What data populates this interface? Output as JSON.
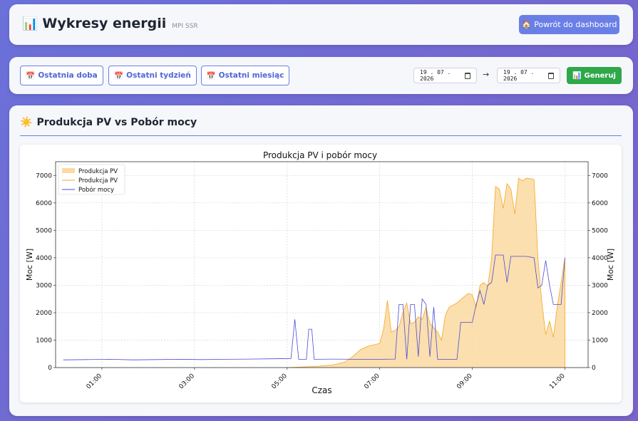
{
  "header": {
    "icon": "bar-chart-icon",
    "title": "Wykresy energii",
    "subtitle": "MPI SSR",
    "back_button": "Powrót do dashboard",
    "back_icon": "home-icon"
  },
  "controls": {
    "ranges": [
      {
        "label": "Ostatnia doba",
        "icon": "calendar-icon"
      },
      {
        "label": "Ostatni tydzień",
        "icon": "calendar-icon"
      },
      {
        "label": "Ostatni miesiąc",
        "icon": "calendar-icon"
      }
    ],
    "date_from": "19 . 07 . 2026",
    "date_to": "19 . 07 . 2026",
    "arrow": "→",
    "generate_button": "Generuj",
    "generate_icon": "chart-icon"
  },
  "section": {
    "icon": "sun-icon",
    "title": "Produkcja PV vs Pobór mocy"
  },
  "colors": {
    "pv_fill": "#fcd9a0",
    "pv_line": "#f5a623",
    "load_line": "#4a4ad8",
    "accent": "#6a7fe6",
    "generate": "#2ea84a"
  },
  "chart_data": {
    "type": "area",
    "title": "Produkcja PV i pobór mocy",
    "xlabel": "Czas",
    "ylabel": "Moc [W]",
    "ylabel_right": "Moc [W]",
    "xlim": [
      "00:00",
      "11:30"
    ],
    "ylim": [
      0,
      7500
    ],
    "x_ticks": [
      "01:00",
      "03:00",
      "05:00",
      "07:00",
      "09:00",
      "11:00"
    ],
    "y_ticks": [
      0,
      1000,
      2000,
      3000,
      4000,
      5000,
      6000,
      7000
    ],
    "grid": true,
    "legend_position": "top-left",
    "legend": [
      "Produkcja PV",
      "Produkcja PV",
      "Pobór mocy"
    ],
    "series": [
      {
        "name": "Produkcja PV",
        "kind": "area",
        "points": [
          [
            "05:00",
            0
          ],
          [
            "05:20",
            20
          ],
          [
            "05:40",
            50
          ],
          [
            "06:00",
            100
          ],
          [
            "06:15",
            200
          ],
          [
            "06:25",
            400
          ],
          [
            "06:35",
            650
          ],
          [
            "06:45",
            780
          ],
          [
            "07:00",
            880
          ],
          [
            "07:05",
            1400
          ],
          [
            "07:10",
            2450
          ],
          [
            "07:15",
            1300
          ],
          [
            "07:20",
            1350
          ],
          [
            "07:25",
            1500
          ],
          [
            "07:30",
            2000
          ],
          [
            "07:35",
            2350
          ],
          [
            "07:40",
            1600
          ],
          [
            "07:45",
            1650
          ],
          [
            "07:50",
            1850
          ],
          [
            "07:55",
            1750
          ],
          [
            "08:00",
            2200
          ],
          [
            "08:05",
            1600
          ],
          [
            "08:10",
            1450
          ],
          [
            "08:15",
            1300
          ],
          [
            "08:20",
            1000
          ],
          [
            "08:25",
            1900
          ],
          [
            "08:30",
            2200
          ],
          [
            "08:40",
            2350
          ],
          [
            "08:50",
            2600
          ],
          [
            "08:55",
            2700
          ],
          [
            "09:00",
            2650
          ],
          [
            "09:05",
            2200
          ],
          [
            "09:10",
            3000
          ],
          [
            "09:15",
            3100
          ],
          [
            "09:20",
            2950
          ],
          [
            "09:25",
            4000
          ],
          [
            "09:30",
            6600
          ],
          [
            "09:35",
            6500
          ],
          [
            "09:40",
            5800
          ],
          [
            "09:45",
            6700
          ],
          [
            "09:50",
            6500
          ],
          [
            "09:55",
            5600
          ],
          [
            "10:00",
            6900
          ],
          [
            "10:05",
            6800
          ],
          [
            "10:10",
            6900
          ],
          [
            "10:15",
            6880
          ],
          [
            "10:20",
            6850
          ],
          [
            "10:25",
            4000
          ],
          [
            "10:30",
            2400
          ],
          [
            "10:35",
            1200
          ],
          [
            "10:40",
            1700
          ],
          [
            "10:45",
            1100
          ],
          [
            "10:50",
            2200
          ],
          [
            "11:00",
            4000
          ],
          [
            "11:00",
            0
          ]
        ]
      },
      {
        "name": "Pobór mocy",
        "kind": "line",
        "points": [
          [
            "00:10",
            280
          ],
          [
            "00:40",
            290
          ],
          [
            "01:10",
            300
          ],
          [
            "01:40",
            280
          ],
          [
            "02:10",
            290
          ],
          [
            "02:40",
            300
          ],
          [
            "03:10",
            290
          ],
          [
            "03:40",
            300
          ],
          [
            "04:10",
            310
          ],
          [
            "04:40",
            320
          ],
          [
            "05:05",
            330
          ],
          [
            "05:10",
            1760
          ],
          [
            "05:15",
            300
          ],
          [
            "05:25",
            300
          ],
          [
            "05:28",
            1400
          ],
          [
            "05:32",
            1400
          ],
          [
            "05:35",
            300
          ],
          [
            "06:00",
            310
          ],
          [
            "06:30",
            300
          ],
          [
            "07:00",
            300
          ],
          [
            "07:20",
            310
          ],
          [
            "07:25",
            2300
          ],
          [
            "07:30",
            2300
          ],
          [
            "07:35",
            300
          ],
          [
            "07:40",
            2300
          ],
          [
            "07:45",
            2300
          ],
          [
            "07:50",
            400
          ],
          [
            "07:55",
            2500
          ],
          [
            "08:00",
            2300
          ],
          [
            "08:05",
            400
          ],
          [
            "08:10",
            2200
          ],
          [
            "08:15",
            300
          ],
          [
            "08:20",
            300
          ],
          [
            "08:40",
            300
          ],
          [
            "08:45",
            1650
          ],
          [
            "09:00",
            1650
          ],
          [
            "09:05",
            2300
          ],
          [
            "09:10",
            2800
          ],
          [
            "09:15",
            2300
          ],
          [
            "09:20",
            3000
          ],
          [
            "09:25",
            3100
          ],
          [
            "09:30",
            4100
          ],
          [
            "09:40",
            4100
          ],
          [
            "09:45",
            3100
          ],
          [
            "09:50",
            4050
          ],
          [
            "10:00",
            4050
          ],
          [
            "10:10",
            4050
          ],
          [
            "10:20",
            4000
          ],
          [
            "10:25",
            2900
          ],
          [
            "10:30",
            3000
          ],
          [
            "10:35",
            3900
          ],
          [
            "10:40",
            3000
          ],
          [
            "10:45",
            2300
          ],
          [
            "10:50",
            2300
          ],
          [
            "10:55",
            2300
          ],
          [
            "11:00",
            4000
          ]
        ]
      }
    ]
  }
}
